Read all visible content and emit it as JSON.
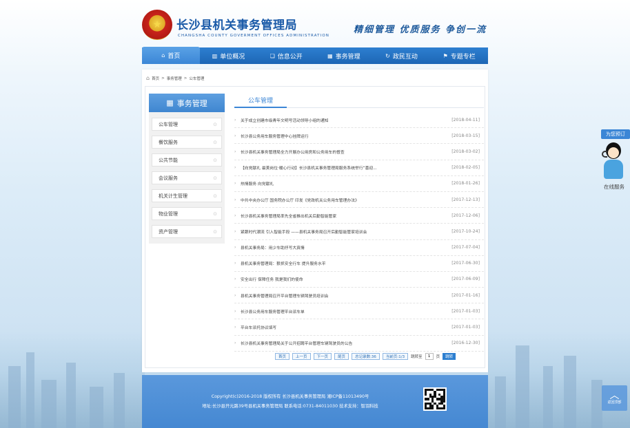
{
  "header": {
    "title": "长沙县机关事务管理局",
    "subtitle": "CHANGSHA COUNTY GOVERMENT OFFICES ADMINISTRATION",
    "slogan": "精细管理 优质服务 争创一流"
  },
  "nav": [
    {
      "label": "首页",
      "icon": "home-icon",
      "glyph": "⌂",
      "active": true
    },
    {
      "label": "单位概况",
      "icon": "building-icon",
      "glyph": "▥"
    },
    {
      "label": "信息公开",
      "icon": "book-icon",
      "glyph": "❏"
    },
    {
      "label": "事务管理",
      "icon": "grid-icon",
      "glyph": "▦"
    },
    {
      "label": "政民互动",
      "icon": "refresh-icon",
      "glyph": "↻"
    },
    {
      "label": "专题专栏",
      "icon": "flag-icon",
      "glyph": "⚑"
    }
  ],
  "breadcrumb": [
    "首页",
    "事务管理",
    "公车管理"
  ],
  "sidebar": {
    "title": "事务管理",
    "items": [
      "公车管理",
      "餐饮服务",
      "公共节能",
      "会议服务",
      "机关计生管理",
      "物业管理",
      "资产管理"
    ]
  },
  "content": {
    "title": "公车管理",
    "rows": [
      {
        "title": "关于成立创建市级青年文明号活动领导小组的通知",
        "date": "[2018-04-11]"
      },
      {
        "title": "长沙县公务用车服务管理中心挂牌运行",
        "date": "[2018-03-15]"
      },
      {
        "title": "长沙县机关事务管理局全力开展办公用房和公务用车的督查",
        "date": "[2018-03-02]"
      },
      {
        "title": "【向党献礼 最美岗位·暖心行动】长沙县机关事务管理局服务系统举行“喜迎...",
        "date": "[2018-02-05]"
      },
      {
        "title": "热情服务 向党献礼",
        "date": "[2018-01-26]"
      },
      {
        "title": "中共中央办公厅 国务院办公厅 印发《党政机关公务用车管理办法》",
        "date": "[2017-12-13]"
      },
      {
        "title": "长沙县机关事务管理局率先全省推出机关后勤智能管家",
        "date": "[2017-12-06]"
      },
      {
        "title": "紧跟时代潮流 引入智能手段 ——县机关事务局召开后勤智能管家培训会",
        "date": "[2017-10-24]"
      },
      {
        "title": "县机关事务局：用少车助抒写大真情",
        "date": "[2017-07-04]"
      },
      {
        "title": "县机关事务管理局：狠抓安全行车 提升服务水平",
        "date": "[2017-06-30]"
      },
      {
        "title": "安全出行 保障任务 我是我们的使命",
        "date": "[2017-06-09]"
      },
      {
        "title": "县机关事务管理局召开平台管理车辆驾驶员培训会",
        "date": "[2017-01-16]"
      },
      {
        "title": "长沙县公务用车服务管理平台派车单",
        "date": "[2017-01-03]"
      },
      {
        "title": "平台车派托协议填写",
        "date": "[2017-01-03]"
      },
      {
        "title": "长沙县机关事务管理局关于公开招聘平台管理车辆驾驶员的公告",
        "date": "[2016-12-30]"
      }
    ]
  },
  "pager": {
    "first": "首页",
    "prev": "上一页",
    "next": "下一页",
    "last": "尾页",
    "total": "总记录数:36",
    "current": "当前页:1/3",
    "jump_label": "跳转至",
    "page_value": "1",
    "page_unit": "页",
    "go": "跳转"
  },
  "footer": {
    "line1": "Copyright(c)2016-2018 版权所有 长沙县机关事务管理局 湘ICP备11013490号",
    "line2": "地址:长沙县开元路39号县机关事务管理局 联系电话:0731-84011030 技术支持：智羽科技"
  },
  "float": {
    "reserve": "为您预订",
    "online": "在线服务",
    "totop": "返回顶部"
  }
}
